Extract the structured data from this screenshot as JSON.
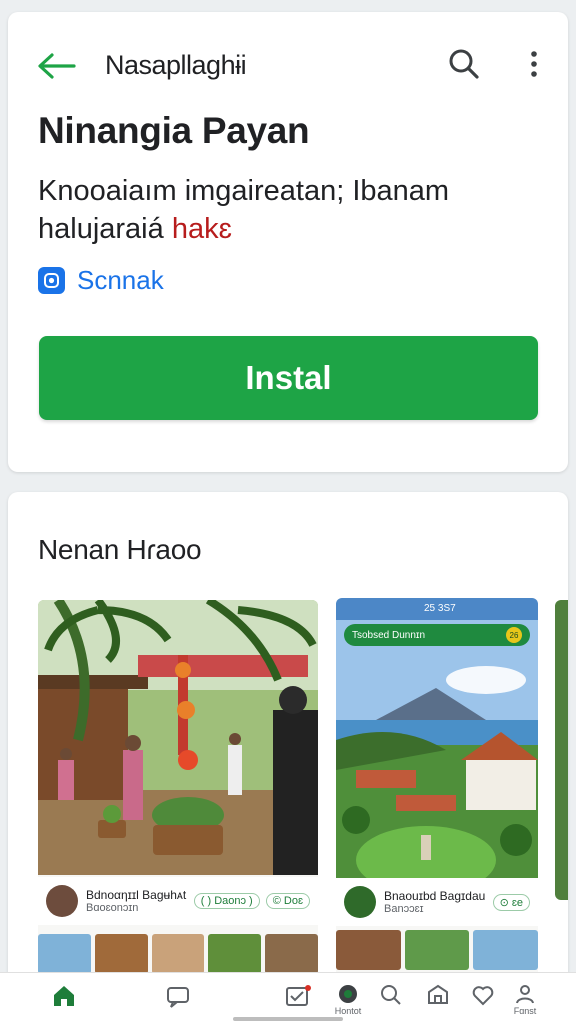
{
  "topbar": {
    "title": "Nasapllaghɨi",
    "back_icon": "arrow-left-icon",
    "search_icon": "search-icon",
    "more_icon": "more-vert-icon"
  },
  "app": {
    "title": "Ninangia Payan",
    "description_line1": "Knooaiaım imgaireatan; Ibanam",
    "description_line2a": "halujaraiá ",
    "description_line2b": "hakɛ",
    "developer": "Scnnak",
    "install_label": "Instal",
    "colors": {
      "accent": "#1ea446",
      "link": "#1a73e8"
    }
  },
  "screenshots": {
    "section_title": "Nenan Hɾaoo",
    "shot1": {
      "name": "Bdnoαηɪɪl Bagʉhᴀt",
      "sub": "Bɑoɛᴏnɔɪn",
      "chip1": "( ) Daonɔ )",
      "chip2": "© Doɛ"
    },
    "shot2": {
      "status_time": "25 3S7",
      "bar_label": "Tsobsed Dunnɪn",
      "bar_num": "26",
      "name": "Bnaouɪbd Bagɪdau",
      "sub": "Banɔɔɛɪ",
      "chip": "⊙ ɛe"
    }
  },
  "bottom_nav": {
    "explore_label": "Hontot",
    "profile_label": "Fɑnst"
  }
}
